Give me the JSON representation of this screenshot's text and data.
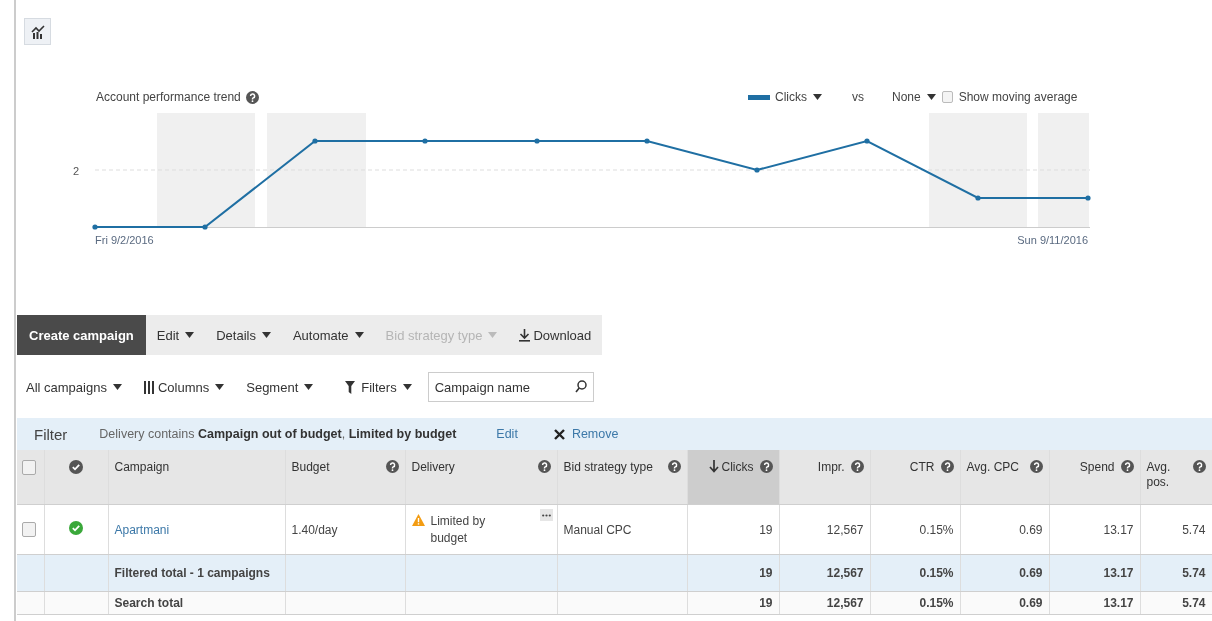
{
  "chart_panel": {
    "title": "Account performance trend",
    "title_help": true,
    "metric": "Clicks",
    "vs": "vs",
    "compare": "None",
    "moving_average": {
      "label": "Show moving average",
      "checked": false
    },
    "y_tick": "2",
    "start_date": "Fri 9/2/2016",
    "end_date": "Sun 9/11/2016"
  },
  "toolbar": [
    {
      "label": "Create campaign",
      "kind": "primary",
      "disabled": false
    },
    {
      "label": "Edit",
      "kind": "menu",
      "disabled": false
    },
    {
      "label": "Details",
      "kind": "menu",
      "disabled": false
    },
    {
      "label": "Automate",
      "kind": "menu",
      "disabled": false
    },
    {
      "label": "Bid strategy type",
      "kind": "menu",
      "disabled": true
    },
    {
      "label": "Download",
      "kind": "download",
      "disabled": false
    }
  ],
  "view_bar": [
    {
      "label": "All campaigns",
      "kind": "menu"
    },
    {
      "label": "Columns",
      "kind": "columns"
    },
    {
      "label": "Segment",
      "kind": "menu"
    },
    {
      "label": "Filters",
      "kind": "filters"
    }
  ],
  "search": {
    "placeholder": "Campaign name"
  },
  "filter_bar": {
    "label": "Filter",
    "text": "Delivery contains **Campaign out of budget**, **Limited by budget**",
    "edit": "Edit",
    "remove": "Remove"
  },
  "table": {
    "header_checked": false,
    "columns": [
      {
        "label": "Campaign",
        "help": false,
        "sorted": false
      },
      {
        "label": "Budget",
        "help": true,
        "sorted": false
      },
      {
        "label": "Delivery",
        "help": true,
        "sorted": false
      },
      {
        "label": "Bid strategy type",
        "help": true,
        "sorted": false
      },
      {
        "label": "Clicks",
        "help": true,
        "sorted": true
      },
      {
        "label": "Impr.",
        "help": true,
        "sorted": false
      },
      {
        "label": "CTR",
        "help": true,
        "sorted": false
      },
      {
        "label": "Avg. CPC",
        "help": true,
        "sorted": false
      },
      {
        "label": "Spend",
        "help": true,
        "sorted": false
      },
      {
        "label": "Avg. pos.",
        "help": true,
        "sorted": false
      }
    ],
    "rows": [
      {
        "kind": "campaign",
        "checked": false,
        "enabled": true,
        "name": "Apartmani",
        "budget": "1.40/day",
        "delivery": "Limited by budget",
        "delivery_warning": true,
        "bid_strategy": "Manual CPC",
        "values": [
          "19",
          "12,567",
          "0.15%",
          "0.69",
          "13.17",
          "5.74"
        ]
      },
      {
        "kind": "filtered_total",
        "name": "Filtered total - 1 campaigns",
        "values": [
          "19",
          "12,567",
          "0.15%",
          "0.69",
          "13.17",
          "5.74"
        ]
      },
      {
        "kind": "search_total",
        "name": "Search total",
        "values": [
          "19",
          "12,567",
          "0.15%",
          "0.69",
          "13.17",
          "5.74"
        ]
      }
    ]
  }
}
